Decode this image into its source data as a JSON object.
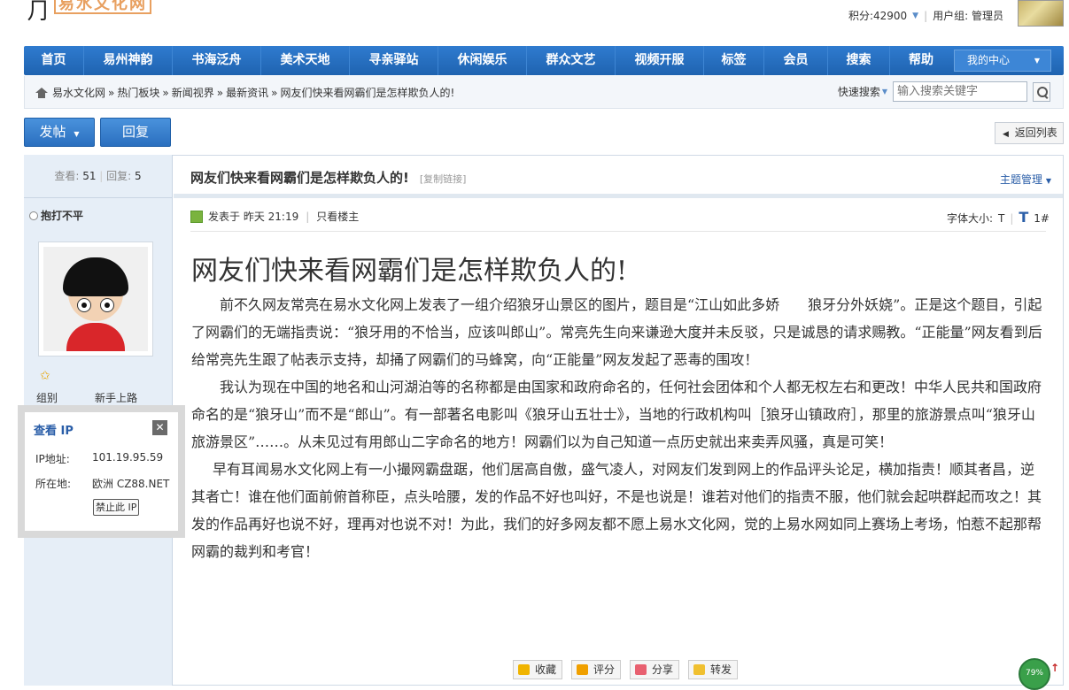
{
  "header": {
    "logo_text": "易水文化网",
    "points": "积分:42900",
    "user_group": "用户组: 管理员"
  },
  "nav": {
    "items": [
      "首页",
      "易州神韵",
      "书海泛舟",
      "美术天地",
      "寻亲驿站",
      "休闲娱乐",
      "群众文艺",
      "视频开服",
      "标签",
      "会员",
      "搜索",
      "帮助"
    ],
    "my_center": "我的中心"
  },
  "breadcrumb": {
    "items": [
      "易水文化网",
      "热门板块",
      "新闻视界",
      "最新资讯",
      "网友们快来看网霸们是怎样欺负人的!"
    ],
    "sep": "»"
  },
  "quick_search": {
    "label": "快速搜索",
    "placeholder": "输入搜索关键字"
  },
  "actions": {
    "post": "发帖",
    "reply": "回复",
    "back": "返回列表"
  },
  "sidebar": {
    "views_label": "查看:",
    "views": "51",
    "replies_label": "回复:",
    "replies": "5",
    "author": "抱打不平",
    "group_label": "组别",
    "group_value": "新手上路"
  },
  "ip_popup": {
    "title": "查看 IP",
    "ip_label": "IP地址:",
    "ip_value": "101.19.95.59",
    "loc_label": "所在地:",
    "loc_value": "欧洲 CZ88.NET",
    "ban_button": "禁止此 IP"
  },
  "post": {
    "title": "网友们快来看网霸们是怎样欺负人的!",
    "copy_link": "[复制链接]",
    "topic_manage": "主题管理",
    "posted_at": "发表于 昨天 21:19",
    "author_only": "只看楼主",
    "font_size_label": "字体大小:",
    "font_small": "T",
    "font_large": "T",
    "floor": "1#",
    "heading": "网友们快来看网霸们是怎样欺负人的!",
    "paragraphs": [
      "前不久网友常亮在易水文化网上发表了一组介绍狼牙山景区的图片，题目是“江山如此多娇　　狼牙分外妖娆”。正是这个题目，引起了网霸们的无端指责说：“狼牙用的不恰当，应该叫郎山”。常亮先生向来谦逊大度并未反驳，只是诚恳的请求赐教。“正能量”网友看到后给常亮先生跟了帖表示支持，却捅了网霸们的马蜂窝，向“正能量”网友发起了恶毒的围攻！",
      "我认为现在中国的地名和山河湖泊等的名称都是由国家和政府命名的，任何社会团体和个人都无权左右和更改！中华人民共和国政府命名的是“狼牙山”而不是“郎山”。有一部著名电影叫《狼牙山五壮士》，当地的行政机构叫［狼牙山镇政府］，那里的旅游景点叫“狼牙山旅游景区”……。从未见过有用郎山二字命名的地方！网霸们以为自己知道一点历史就出来卖弄风骚，真是可笑！",
      "早有耳闻易水文化网上有一小撮网霸盘踞，他们居高自傲，盛气凌人，对网友们发到网上的作品评头论足，横加指责！顺其者昌，逆其者亡！谁在他们面前俯首称臣，点头哈腰，发的作品不好也叫好，不是也说是！谁若对他们的指责不服，他们就会起哄群起而攻之！其发的作品再好也说不好，理再对也说不对！为此，我们的好多网友都不愿上易水文化网，觉的上易水网如同上赛场上考场，怕惹不起那帮网霸的裁判和考官！"
    ]
  },
  "bottom_buttons": [
    "收藏",
    "评分",
    "分享",
    "转发"
  ],
  "ring_text": "79%"
}
